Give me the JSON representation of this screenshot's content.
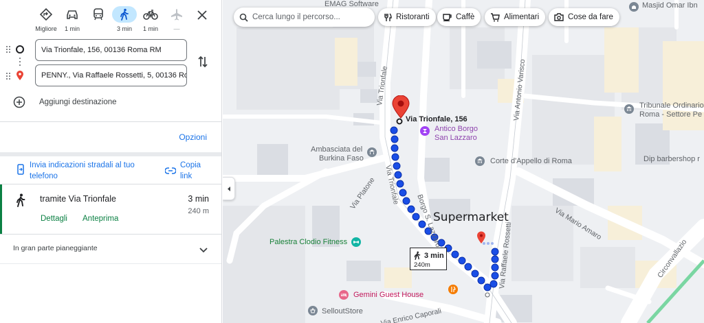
{
  "modes": [
    {
      "name": "Migliore",
      "icon": "best-route-icon"
    },
    {
      "name": "1 min",
      "icon": "car-icon"
    },
    {
      "name": "",
      "icon": "transit-icon"
    },
    {
      "name": "3 min",
      "icon": "walking-icon"
    },
    {
      "name": "1 min",
      "icon": "bicycle-icon"
    },
    {
      "name": "—",
      "icon": "flight-icon"
    }
  ],
  "route": {
    "origin": "Via Trionfale, 156, 00136 Roma RM",
    "destination": "PENNY., Via Raffaele Rossetti, 5, 00136 Roma RM",
    "add_destination": "Aggiungi destinazione"
  },
  "options_label": "Opzioni",
  "send": {
    "label": "Invia indicazioni stradali al tuo telefono",
    "copy_link": "Copia link"
  },
  "route_card": {
    "title": "tramite Via Trionfale",
    "time": "3 min",
    "distance": "240 m",
    "details": "Dettagli",
    "preview": "Anteprima"
  },
  "terrain_note": "In gran parte pianeggiante",
  "map": {
    "search_placeholder": "Cerca lungo il percorso...",
    "chips": [
      "Ristoranti",
      "Caffè",
      "Alimentari",
      "Cose da fare"
    ],
    "origin_label": "Via Trionfale, 156",
    "annotation": "Supermarket",
    "tooltip_time": "3 min",
    "tooltip_distance": "240m",
    "places": {
      "emag": "EMAG Software",
      "masjid": "Masjid Omar Ibn",
      "tribunale1": "Tribunale Ordinario",
      "tribunale2": "Roma - Settore Pe",
      "antico1": "Antico Borgo",
      "antico2": "San Lazzaro",
      "ambasciata1": "Ambasciata del",
      "ambasciata2": "Burkina Faso",
      "corte": "Corte d'Appello di Roma",
      "dip": "Dip barbershop r",
      "palestra": "Palestra Clodio Fitness",
      "gemini": "Gemini Guest House",
      "sellout": "SelloutStore"
    },
    "roads": {
      "trionfale1": "Via Trionfale",
      "trionfale2": "Via Trionfale",
      "varisco": "Via Antonio Varisco",
      "rossetti": "Via Raffaele Rossetti",
      "piatone": "Via Platone",
      "borgo": "Borgo S. Lazzaro",
      "amaro": "Via Mario Amaro",
      "circonvallazione": "Circonvallazio",
      "caporali": "Via Enrico Caporali"
    }
  }
}
